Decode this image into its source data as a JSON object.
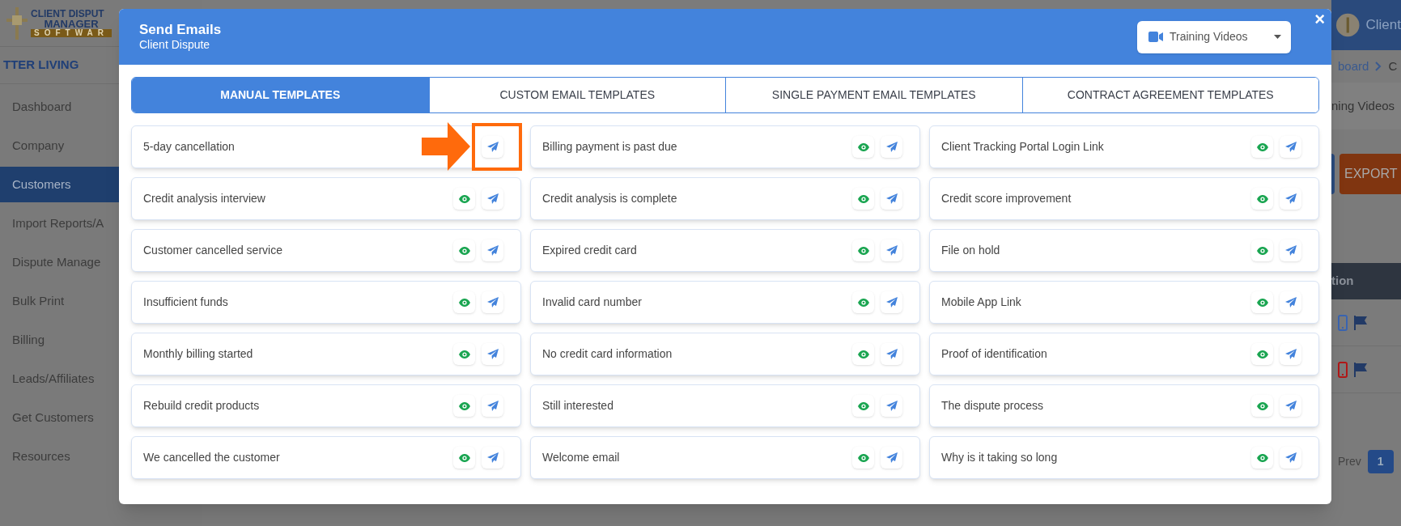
{
  "background": {
    "logo": [
      "CLIENT DISPUT",
      "MANAGER",
      "SOFTWAR"
    ],
    "account": "TTER LIVING",
    "menu": [
      {
        "label": "Dashboard",
        "selected": false
      },
      {
        "label": "Company",
        "selected": false
      },
      {
        "label": "Customers",
        "selected": true
      },
      {
        "label": "Import Reports/A",
        "selected": false
      },
      {
        "label": "Dispute Manage",
        "selected": false
      },
      {
        "label": "Bulk Print",
        "selected": false
      },
      {
        "label": "Billing",
        "selected": false
      },
      {
        "label": "Leads/Affiliates",
        "selected": false
      },
      {
        "label": "Get Customers",
        "selected": false
      },
      {
        "label": "Resources",
        "selected": false
      }
    ],
    "user": "Client",
    "breadcrumb": [
      "board",
      "C"
    ],
    "videos_link": "ning Videos",
    "export_button": "EXPORT",
    "table_header": "tion",
    "table_rows": [
      {
        "color": "#3a64b0"
      },
      {
        "color": "#b01818"
      }
    ],
    "pagination": {
      "prev": "Prev",
      "page": "1"
    }
  },
  "modal": {
    "title": "Send Emails",
    "subtitle": "Client Dispute",
    "videos_button": "Training Videos",
    "close": "×",
    "tabs": [
      {
        "label": "MANUAL TEMPLATES",
        "selected": true
      },
      {
        "label": "CUSTOM EMAIL TEMPLATES",
        "selected": false
      },
      {
        "label": "SINGLE PAYMENT EMAIL TEMPLATES",
        "selected": false
      },
      {
        "label": "CONTRACT AGREEMENT TEMPLATES",
        "selected": false
      }
    ],
    "templates": [
      {
        "name": "5-day cancellation",
        "highlighted": true
      },
      {
        "name": "Billing payment is past due",
        "highlighted": false
      },
      {
        "name": "Client Tracking Portal Login Link",
        "highlighted": false
      },
      {
        "name": "Credit analysis interview",
        "highlighted": false
      },
      {
        "name": "Credit analysis is complete",
        "highlighted": false
      },
      {
        "name": "Credit score improvement",
        "highlighted": false
      },
      {
        "name": "Customer cancelled service",
        "highlighted": false
      },
      {
        "name": "Expired credit card",
        "highlighted": false
      },
      {
        "name": "File on hold",
        "highlighted": false
      },
      {
        "name": "Insufficient funds",
        "highlighted": false
      },
      {
        "name": "Invalid card number",
        "highlighted": false
      },
      {
        "name": "Mobile App Link",
        "highlighted": false
      },
      {
        "name": "Monthly billing started",
        "highlighted": false
      },
      {
        "name": "No credit card information",
        "highlighted": false
      },
      {
        "name": "Proof of identification",
        "highlighted": false
      },
      {
        "name": "Rebuild credit products",
        "highlighted": false
      },
      {
        "name": "Still interested",
        "highlighted": false
      },
      {
        "name": "The dispute process",
        "highlighted": false
      },
      {
        "name": "We cancelled the customer",
        "highlighted": false
      },
      {
        "name": "Welcome email",
        "highlighted": false
      },
      {
        "name": "Why is it taking so long",
        "highlighted": false
      }
    ]
  }
}
